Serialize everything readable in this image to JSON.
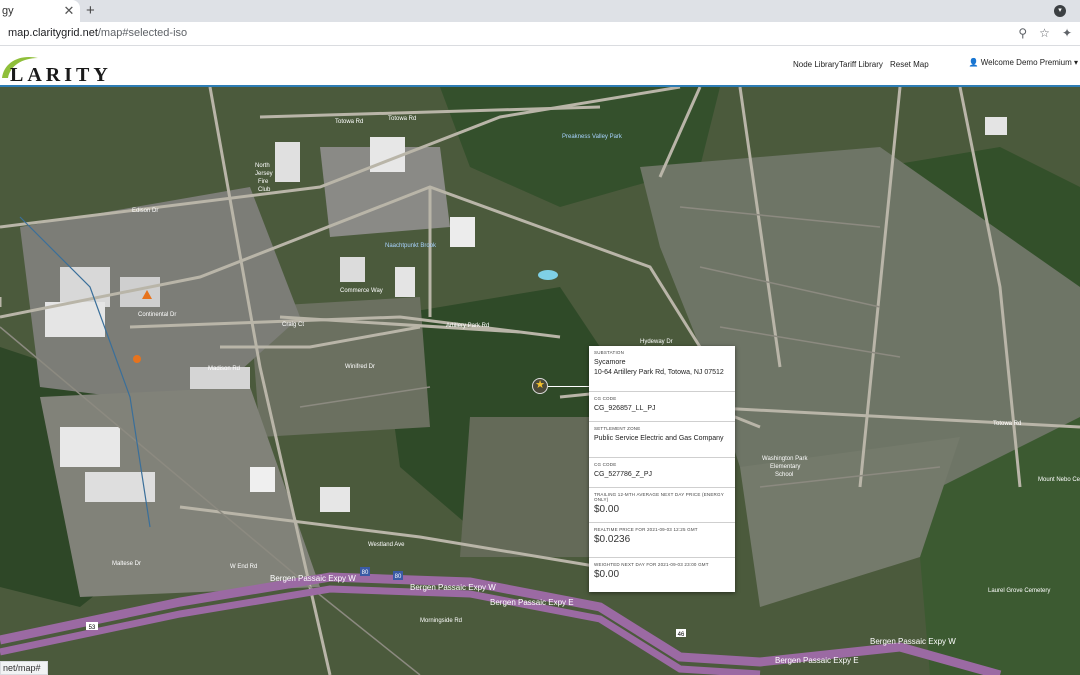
{
  "browser": {
    "tab_title": "gy",
    "tab_close": "✕",
    "new_tab": "+",
    "url_host": "map.claritygrid.net",
    "url_path": "/map#selected-iso",
    "status_url": "net/map#"
  },
  "header": {
    "logo_text": "LARITY",
    "nav": [
      "Node Library",
      "Tariff Library",
      "Reset Map"
    ],
    "welcome": "Welcome Demo Premium"
  },
  "map": {
    "labels": [
      "Totowa Rd",
      "Preakness Valley Park",
      "Naachtpunkt Brook",
      "Edison Dr",
      "North Jersey Fire Club",
      "Commerce Way",
      "Continental Dr",
      "Artillery Park Rd",
      "Madison Rd",
      "Winifred Dr",
      "Washington Park Elementary School",
      "Mount Nebo Cem",
      "Laurel Grove Cemetery",
      "Bergen Passaic Expy W",
      "Bergen Passaic Expy E",
      "W End Rd",
      "Westland Ave",
      "Maltese Dr",
      "Hydeway Dr",
      "Craig Ct",
      "Morningside Rd"
    ],
    "shields": [
      "80",
      "80",
      "46",
      "53"
    ]
  },
  "popup": {
    "substation_label": "SUBSTATION",
    "substation_name": "Sycamore",
    "substation_address": "10-64 Artillery Park Rd, Totowa, NJ 07512",
    "cg_code_label": "CG CODE",
    "cg_code": "CG_926857_LL_PJ",
    "zone_label": "SETTLEMENT ZONE",
    "zone_name": "Public Service Electric and Gas Company",
    "zone_cg_code_label": "CG CODE",
    "zone_cg_code": "CG_527786_Z_PJ",
    "trailing_label": "TRAILING 12-MTH AVERAGE NEXT DAY PRICE (Energy only)",
    "trailing_value": "$0.00",
    "realtime_label": "REALTIME PRICE FOR 2021-09-03 12:25 GMT",
    "realtime_value": "$0.0236",
    "weighted_label": "WEIGHTED NEXT DAY FOR 2021-09-03 23:00 GMT",
    "weighted_value": "$0.00"
  },
  "colors": {
    "header_border": "#2e7db5",
    "highway": "#9b6aa3",
    "marker_star": "#f2c12e",
    "marker_orange": "#e6731e"
  }
}
